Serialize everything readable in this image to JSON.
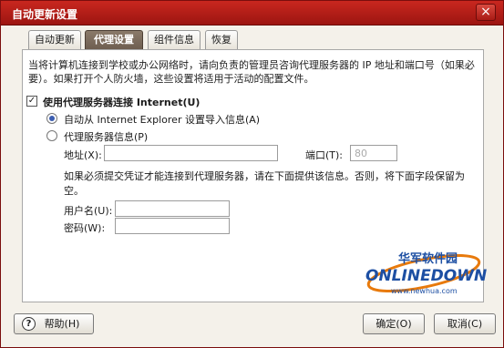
{
  "window": {
    "title": "自动更新设置",
    "close_label": "×"
  },
  "tabs": [
    {
      "label": "自动更新",
      "active": false
    },
    {
      "label": "代理设置",
      "active": true
    },
    {
      "label": "组件信息",
      "active": false
    },
    {
      "label": "恢复",
      "active": false
    }
  ],
  "intro_text": "当将计算机连接到学校或办公网络时，请向负责的管理员咨询代理服务器的 IP 地址和端口号（如果必要）。如果打开个人防火墙，这些设置将适用于活动的配置文件。",
  "proxy": {
    "use_proxy_label": "使用代理服务器连接 Internet(U)",
    "use_proxy_checked": true,
    "auto_import_label": "自动从 Internet Explorer 设置导入信息(A)",
    "manual_label": "代理服务器信息(P)",
    "address_label": "地址(X):",
    "address_value": "",
    "port_label": "端口(T):",
    "port_value": "80"
  },
  "credentials": {
    "note": "如果必须提交凭证才能连接到代理服务器，请在下面提供该信息。否则，将下面字段保留为空。",
    "username_label": "用户名(U):",
    "username_value": "",
    "password_label": "密码(W):",
    "password_value": ""
  },
  "buttons": {
    "help": "帮助(H)",
    "help_icon": "?",
    "ok": "确定(O)",
    "cancel": "取消(C)"
  },
  "watermark": {
    "cn_text": "华军软件园",
    "brand": "ONLINEDOWN",
    "url": "www.newhua.com"
  },
  "colors": {
    "titlebar": "#b01c16",
    "accent_blue": "#1d4fa3",
    "watermark_orange": "#e87a0c"
  }
}
